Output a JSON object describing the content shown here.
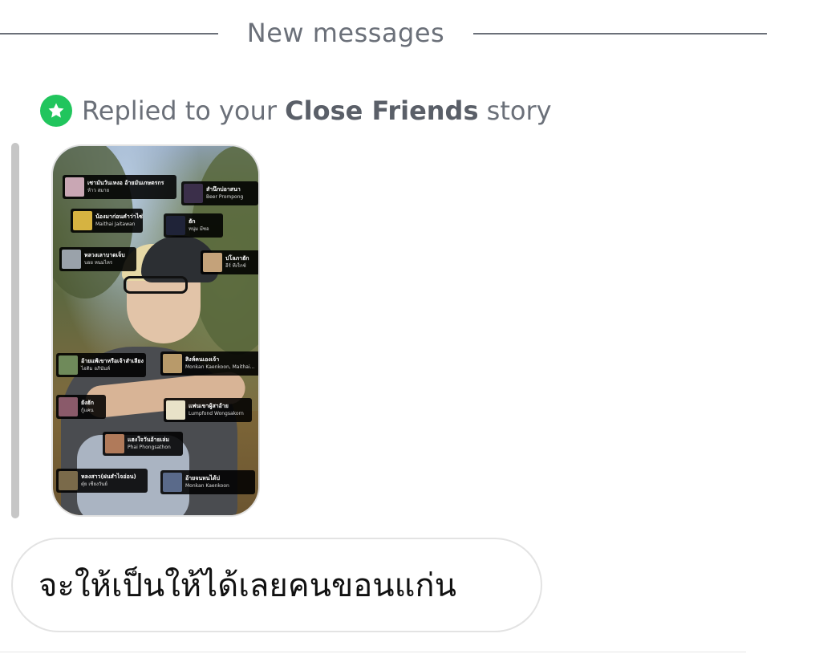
{
  "divider": {
    "label": "New messages"
  },
  "reply_header": {
    "prefix": "Replied to your ",
    "highlight": "Close Friends",
    "suffix": " story",
    "icon": "star-icon",
    "icon_color": "#21c55d"
  },
  "story": {
    "tags": [
      {
        "title": "เซามันวันเหงอ อ้ายมันเกษตรกร",
        "artist": "ห้าว สมาย"
      },
      {
        "title": "สำนึกบ่อาสนา",
        "artist": "Beer Prompong"
      },
      {
        "title": "น้องมาก่อนคำว่าไซ่",
        "artist": "Maithai Jaitawan"
      },
      {
        "title": "ฮัก",
        "artist": "หนุ่ม มีซอ"
      },
      {
        "title": "หลวงเลาบาดเจ็บ",
        "artist": "บอย หนมไหร"
      },
      {
        "title": "ปโลภาฮัก",
        "artist": "อีร์ ทีเร็กซ์"
      },
      {
        "title": "อ้ายแพ้เขาหรือเจ้าสำเลียง",
        "artist": "ไอติม อภินันท์"
      },
      {
        "title": "สิงห์คนเองเจ้า",
        "artist": "Monkan Kaenkoon, Maithai..."
      },
      {
        "title": "ยังฮัก",
        "artist": "กู้แคน"
      },
      {
        "title": "แฟนเขาผู้สาอ้าย",
        "artist": "Lumpfond Wongsakorn"
      },
      {
        "title": "แฮงใจวันอ้ายเล่ม",
        "artist": "Phai Phongsathon"
      },
      {
        "title": "หลงสาว(ฝนสำไจอ่อน)",
        "artist": "ตุ๋ย เชียงวันย์"
      },
      {
        "title": "อ้ายจนหนได้บ่",
        "artist": "Monkan Kaenkoon"
      }
    ]
  },
  "message": {
    "text": "จะให้เป็นให้ได้เลยคนขอนแก่น"
  }
}
